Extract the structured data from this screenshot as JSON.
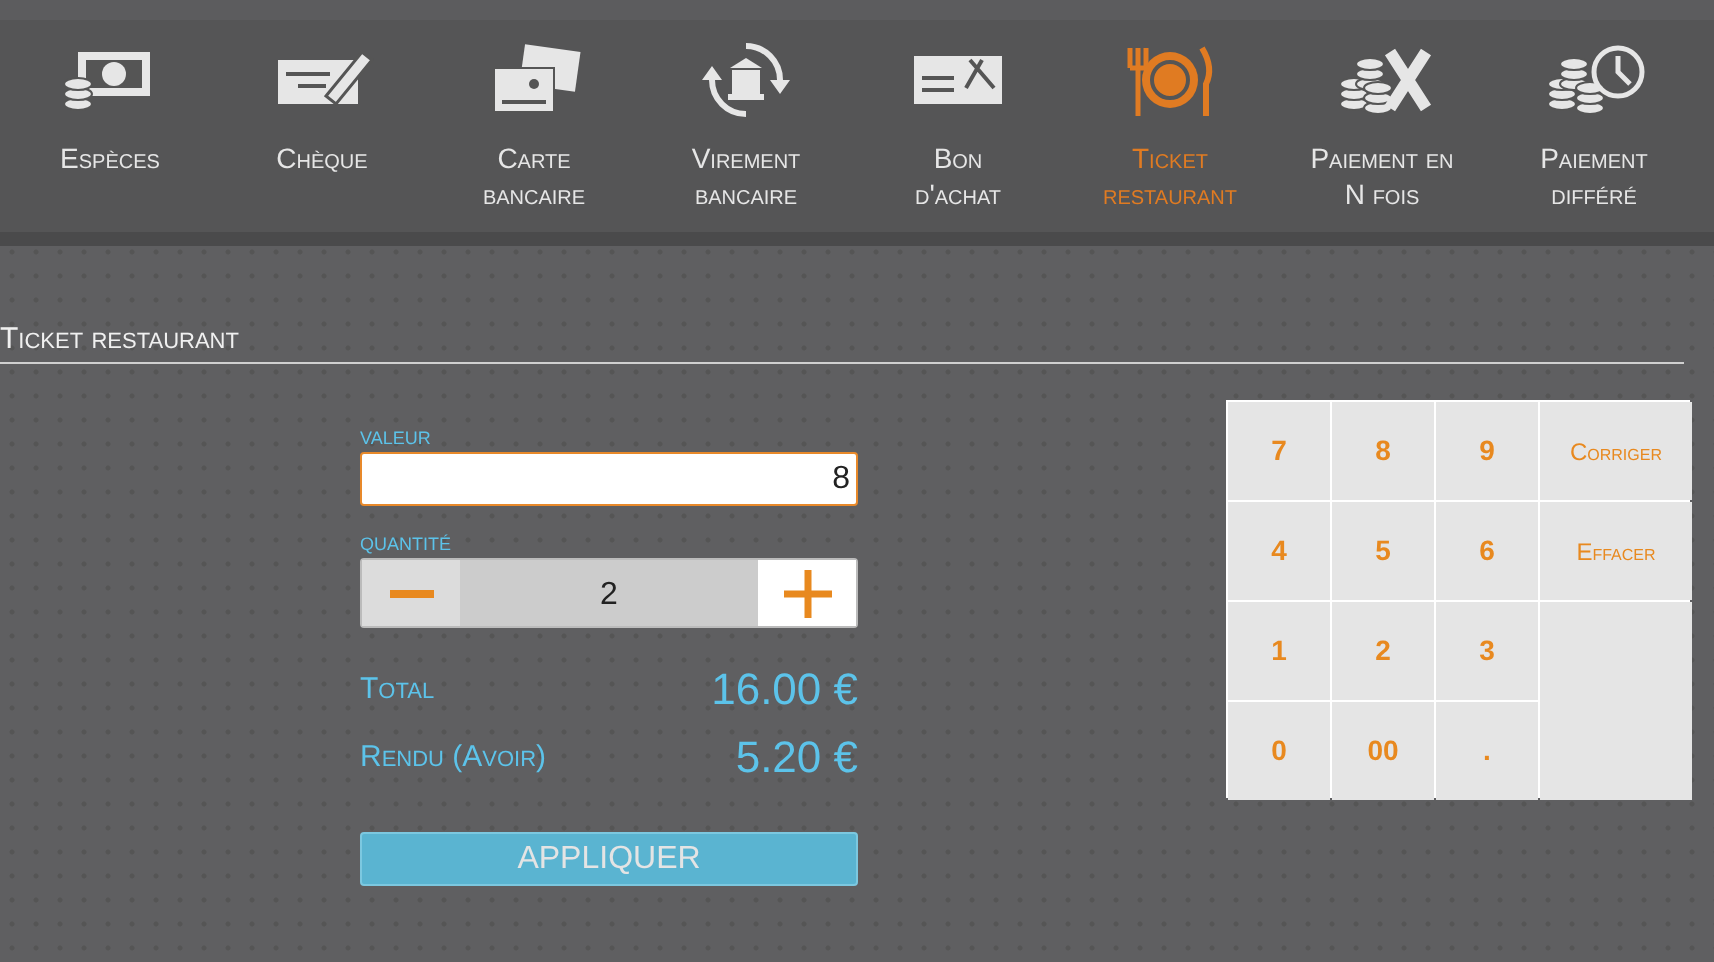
{
  "payment_tabs": [
    {
      "label": "Espèces",
      "selected": false
    },
    {
      "label": "Chèque",
      "selected": false
    },
    {
      "label": "Carte\nbancaire",
      "selected": false
    },
    {
      "label": "Virement\nbancaire",
      "selected": false
    },
    {
      "label": "Bon\nd'achat",
      "selected": false
    },
    {
      "label": "Ticket\nrestaurant",
      "selected": true
    },
    {
      "label": "Paiement en\nN fois",
      "selected": false
    },
    {
      "label": "Paiement\ndifféré",
      "selected": false
    }
  ],
  "section_title": "Ticket restaurant",
  "value_field": {
    "label": "VALEUR",
    "value": "8"
  },
  "quantity": {
    "label": "QUANTITÉ",
    "value": "2"
  },
  "summary": [
    {
      "label": "Total",
      "amount": "16.00 €"
    },
    {
      "label": "Rendu (Avoir)",
      "amount": "5.20 €"
    }
  ],
  "apply_button": "APPLIQUER",
  "keypad": [
    {
      "label": "7",
      "kind": "digit"
    },
    {
      "label": "8",
      "kind": "digit"
    },
    {
      "label": "9",
      "kind": "digit"
    },
    {
      "label": "Corriger",
      "kind": "action"
    },
    {
      "label": "4",
      "kind": "digit"
    },
    {
      "label": "5",
      "kind": "digit"
    },
    {
      "label": "6",
      "kind": "digit"
    },
    {
      "label": "Effacer",
      "kind": "action"
    },
    {
      "label": "1",
      "kind": "digit"
    },
    {
      "label": "2",
      "kind": "digit"
    },
    {
      "label": "3",
      "kind": "digit"
    },
    {
      "label": "0",
      "kind": "digit"
    },
    {
      "label": "00",
      "kind": "digit"
    },
    {
      "label": ".",
      "kind": "digit"
    }
  ]
}
